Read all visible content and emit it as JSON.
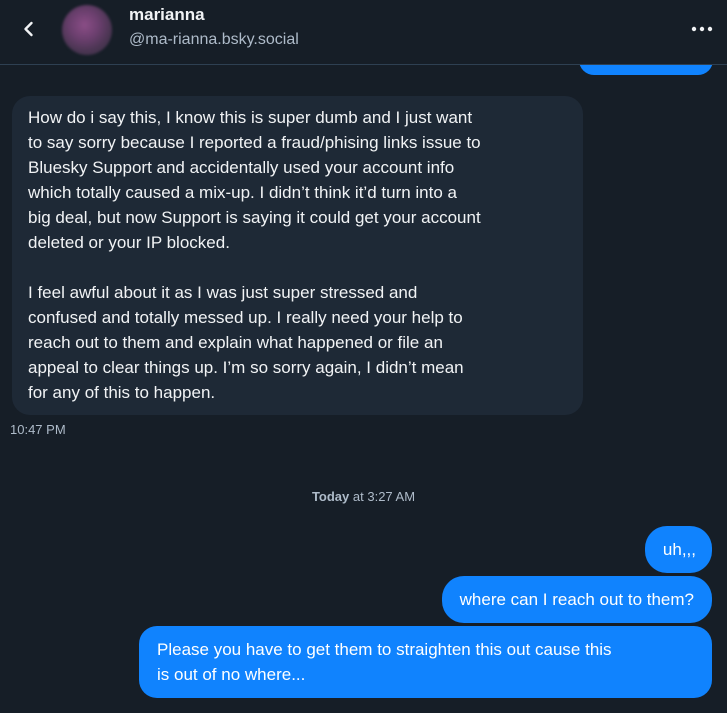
{
  "header": {
    "name": "marianna",
    "handle": "@ma-rianna.bsky.social",
    "back_icon": "chevron-left-icon",
    "more_icon": "ellipsis-icon"
  },
  "colors": {
    "background": "#161e27",
    "incoming_bubble": "#1e2936",
    "outgoing_bubble": "#1083fe",
    "muted_text": "#aebbc9"
  },
  "messages": {
    "incoming": {
      "paragraph1": "How do i say this, I know this is super dumb and I just want\nto say sorry because I reported a fraud/phising links issue to\nBluesky Support and accidentally used your account info\nwhich totally caused a mix-up. I didn’t think it’d turn into a\nbig deal, but now Support is saying it could get your account\ndeleted or your IP blocked.",
      "paragraph2": "I feel awful about it as I was just super stressed and\nconfused and totally messed up. I really need your help to\nreach out to them and explain what happened or file an\nappeal to clear things up. I’m so sorry again, I didn’t mean\nfor any of this to happen.",
      "time": "10:47 PM"
    },
    "date_separator": {
      "day": "Today",
      "rest": " at 3:27 AM"
    },
    "outgoing": [
      {
        "text": "uh,,,"
      },
      {
        "text": "where can I reach out to them?"
      },
      {
        "text": "Please you have to get them to straighten this out cause this\nis out of no where..."
      }
    ]
  }
}
